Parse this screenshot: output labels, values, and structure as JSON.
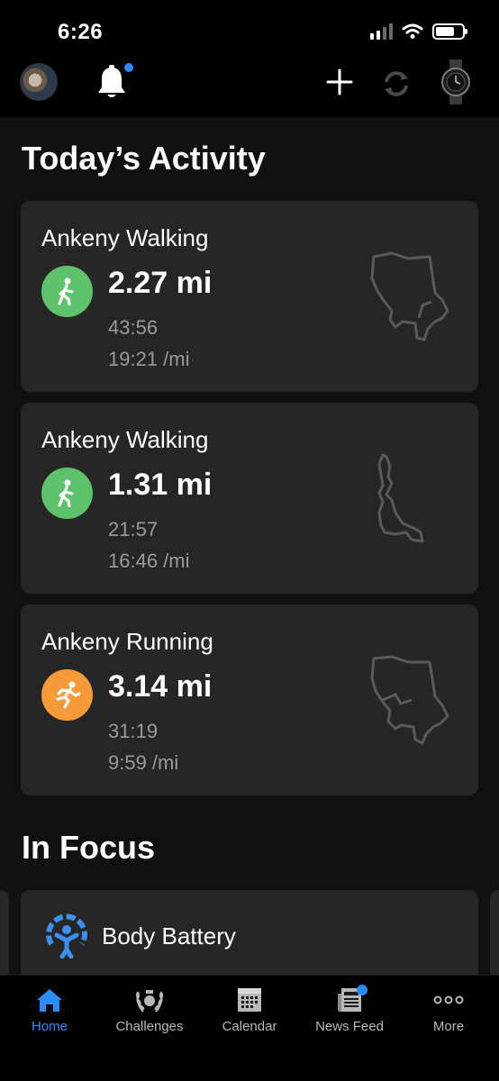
{
  "status_bar": {
    "time": "6:26"
  },
  "header": {
    "avatar": "profile-avatar",
    "icons": [
      "bell-icon",
      "plus-icon",
      "sync-icon",
      "watch-icon"
    ],
    "notification_dot_color": "#2a8cff"
  },
  "today": {
    "title": "Today’s Activity",
    "activities": [
      {
        "name": "Ankeny Walking",
        "distance": "2.27 mi",
        "duration": "43:56",
        "pace": "19:21 /mi",
        "type": "walking",
        "icon_color": "#5ec26a"
      },
      {
        "name": "Ankeny Walking",
        "distance": "1.31 mi",
        "duration": "21:57",
        "pace": "16:46 /mi",
        "type": "walking",
        "icon_color": "#5ec26a"
      },
      {
        "name": "Ankeny Running",
        "distance": "3.14 mi",
        "duration": "31:19",
        "pace": "9:59 /mi",
        "type": "running",
        "icon_color": "#f79a3a"
      }
    ]
  },
  "focus": {
    "title": "In Focus",
    "card_label": "Body Battery",
    "icon_color": "#3d8ff0"
  },
  "tabs": [
    {
      "label": "Home",
      "icon": "home-icon",
      "active": true
    },
    {
      "label": "Challenges",
      "icon": "laurel-icon",
      "active": false
    },
    {
      "label": "Calendar",
      "icon": "calendar-icon",
      "active": false
    },
    {
      "label": "News Feed",
      "icon": "newspaper-icon",
      "active": false
    },
    {
      "label": "More",
      "icon": "more-icon",
      "active": false
    }
  ],
  "colors": {
    "accent": "#2a8cff",
    "card": "#262626",
    "background": "#111111",
    "secondary_text": "#9a9a9a"
  }
}
